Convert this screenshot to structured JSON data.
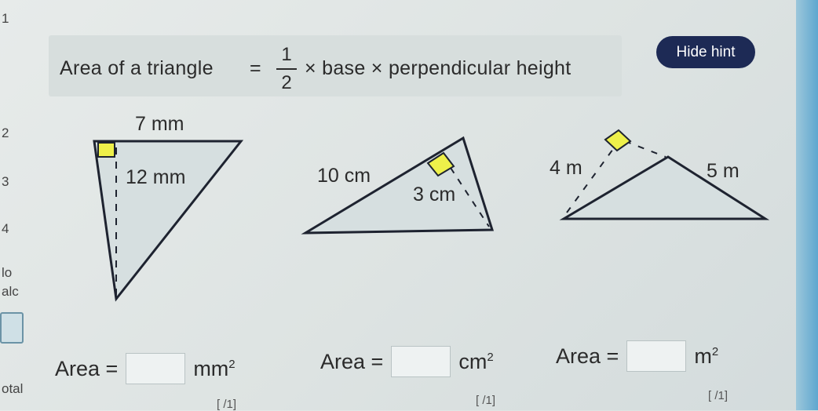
{
  "side_nav": [
    "1",
    "2",
    "3",
    "4",
    "lo",
    "alc",
    "otal"
  ],
  "hint": {
    "label": "Area of a triangle",
    "equals": "=",
    "fraction_numerator": "1",
    "fraction_denominator": "2",
    "rest": "× base × perpendicular height",
    "button": "Hide hint"
  },
  "figures": [
    {
      "labels": [
        "7 mm",
        "12 mm"
      ]
    },
    {
      "labels": [
        "10 cm",
        "3 cm"
      ]
    },
    {
      "labels": [
        "4 m",
        "5 m"
      ]
    }
  ],
  "answers": [
    {
      "label": "Area =",
      "unit": "mm",
      "power": "2",
      "mark": "[ /1]"
    },
    {
      "label": "Area =",
      "unit": "cm",
      "power": "2",
      "mark": "[ /1]"
    },
    {
      "label": "Area =",
      "unit": "m",
      "power": "2",
      "mark": "[ /1]"
    }
  ],
  "colors": {
    "button": "#1d2a55",
    "triangle_fill": "#d6dfe0",
    "right_angle": "#eef04a"
  }
}
